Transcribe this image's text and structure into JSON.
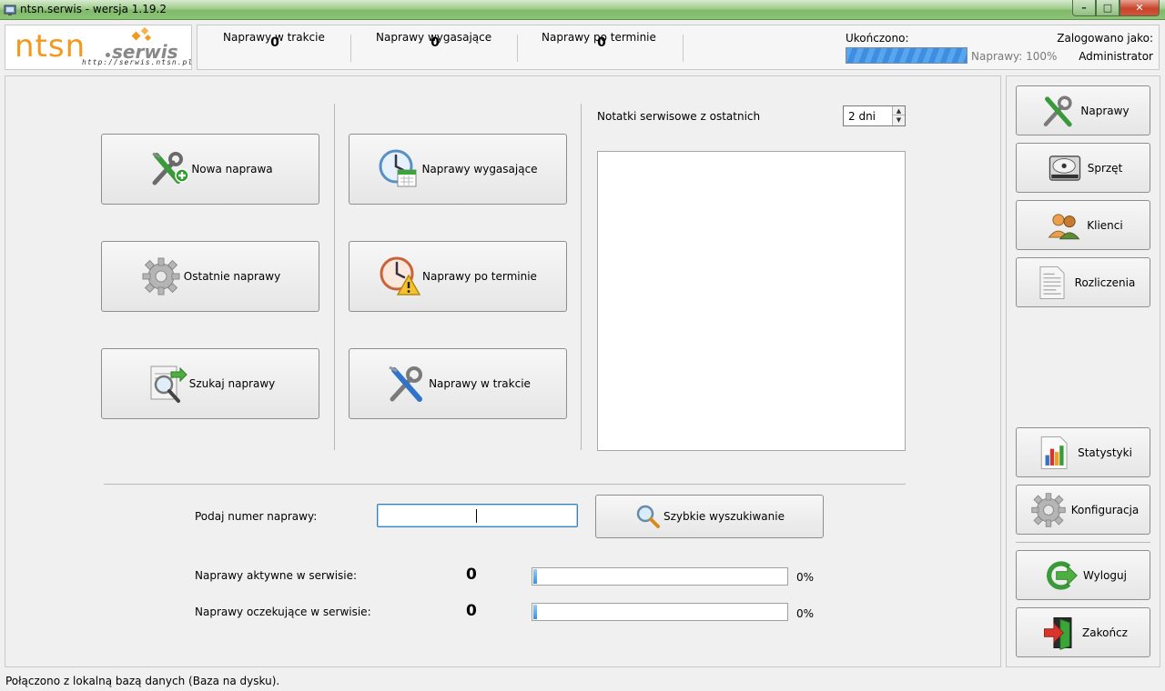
{
  "window": {
    "title": "ntsn.serwis - wersja 1.19.2",
    "min_symbol": "–",
    "max_symbol": "□",
    "close_symbol": "✕"
  },
  "logo": {
    "brand": "ntsn",
    "suffix": "serwis",
    "url": "http://serwis.ntsn.pl"
  },
  "header": {
    "stats": [
      {
        "label": "Naprawy w trakcie",
        "value": "0"
      },
      {
        "label": "Naprawy wygasające",
        "value": "0"
      },
      {
        "label": "Naprawy po terminie",
        "value": "0"
      }
    ],
    "completed_label": "Ukończono:",
    "completed_fraction": 1.0,
    "completed_text": "Naprawy: 100%",
    "logged_label": "Zalogowano jako:",
    "logged_user": "Administrator"
  },
  "main": {
    "buttons": {
      "new_repair": "Nowa naprawa",
      "recent_repairs": "Ostatnie naprawy",
      "search_repair": "Szukaj naprawy",
      "expiring_repairs": "Naprawy wygasające",
      "overdue_repairs": "Naprawy po terminie",
      "in_progress_repairs": "Naprawy w trakcie"
    },
    "notes": {
      "label": "Notatki serwisowe z ostatnich",
      "days_value": "2 dni"
    },
    "quick_search": {
      "label": "Podaj numer naprawy:",
      "value": "",
      "button_label": "Szybkie wyszukiwanie"
    },
    "active": {
      "label": "Naprawy aktywne w serwisie:",
      "count": "0",
      "percent": "0%",
      "fraction": 0.0
    },
    "waiting": {
      "label": "Naprawy oczekujące w serwisie:",
      "count": "0",
      "percent": "0%",
      "fraction": 0.0
    }
  },
  "sidebar": {
    "items": [
      "Naprawy",
      "Sprzęt",
      "Klienci",
      "Rozliczenia",
      "Statystyki",
      "Konfiguracja",
      "Wyloguj",
      "Zakończ"
    ]
  },
  "status_bar": {
    "text": "Połączono z lokalną bazą danych (Baza na dysku)."
  }
}
